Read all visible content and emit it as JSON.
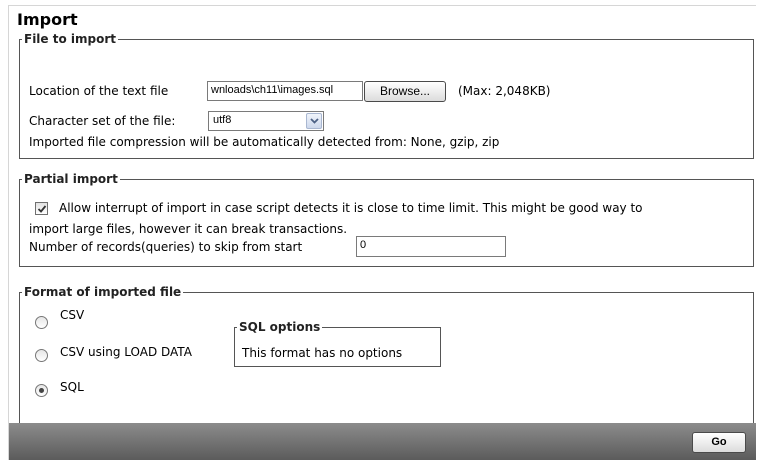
{
  "page_title": "Import",
  "file_section": {
    "legend": "File to import",
    "location_label": "Location of the text file",
    "location_value": "wnloads\\ch11\\images.sql",
    "browse_label": "Browse...",
    "max_note": "(Max: 2,048KB)",
    "charset_label": "Character set of the file:",
    "charset_value": "utf8",
    "compression_note": "Imported file compression will be automatically detected from: None, gzip, zip"
  },
  "partial_section": {
    "legend": "Partial import",
    "allow_interrupt_checked": true,
    "allow_interrupt_line1": "Allow interrupt of import in case script detects it is close to time limit. This might be good way to",
    "allow_interrupt_line2": "import large files, however it can break transactions.",
    "skip_label": "Number of records(queries) to skip from start",
    "skip_value": "0"
  },
  "format_section": {
    "legend": "Format of imported file",
    "options": [
      {
        "label": "CSV",
        "selected": false
      },
      {
        "label": "CSV using LOAD DATA",
        "selected": false
      },
      {
        "label": "SQL",
        "selected": true
      }
    ],
    "sql_options_legend": "SQL options",
    "sql_options_text": "This format has no options"
  },
  "footer": {
    "go_label": "Go"
  }
}
